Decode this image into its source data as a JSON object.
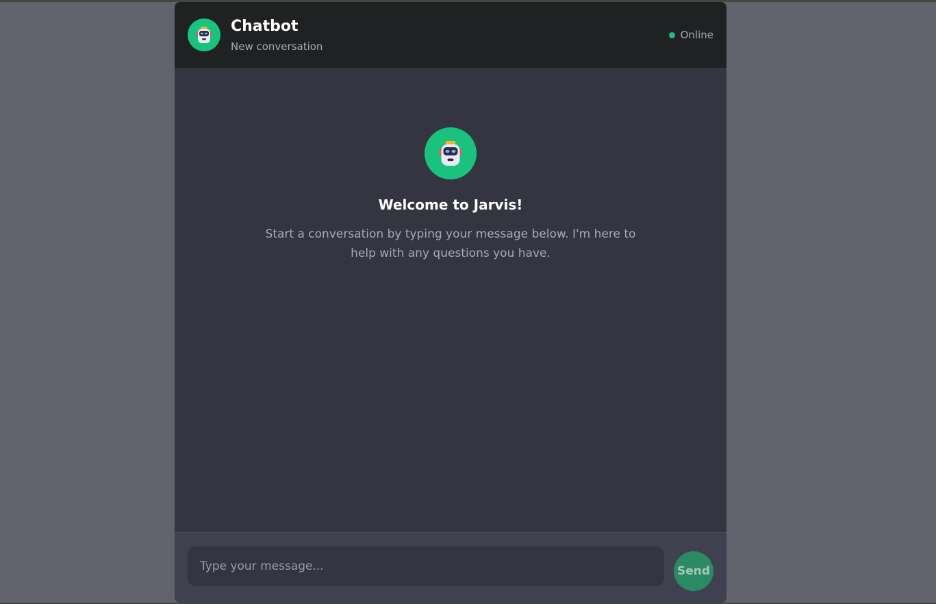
{
  "header": {
    "title": "Chatbot",
    "subtitle": "New conversation",
    "status": "Online",
    "avatar_icon": "robot-icon"
  },
  "welcome": {
    "title": "Welcome to Jarvis!",
    "text": "Start a conversation by typing your message below. I'm here to help with any questions you have.",
    "avatar_icon": "robot-icon"
  },
  "composer": {
    "placeholder": "Type your message...",
    "value": "",
    "send_label": "Send"
  },
  "colors": {
    "accent": "#19c37d",
    "header_bg": "#202123",
    "chat_bg": "#353541",
    "page_bg": "#62626c"
  }
}
